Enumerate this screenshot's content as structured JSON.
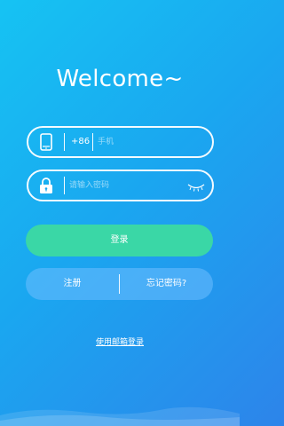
{
  "welcome": {
    "title": "Welcome~"
  },
  "phone": {
    "country_code": "+86",
    "placeholder": "手机"
  },
  "password": {
    "placeholder": "请输入密码"
  },
  "actions": {
    "login_label": "登录",
    "register_label": "注册",
    "forgot_label": "忘记密码?",
    "email_login_label": "使用邮箱登录"
  },
  "icons": {
    "phone": "phone-icon",
    "lock": "lock-icon",
    "eye": "eye-closed-icon"
  },
  "colors": {
    "background_start": "#16c3f3",
    "background_end": "#2d84ea",
    "login_button": "#3ad7a6"
  }
}
